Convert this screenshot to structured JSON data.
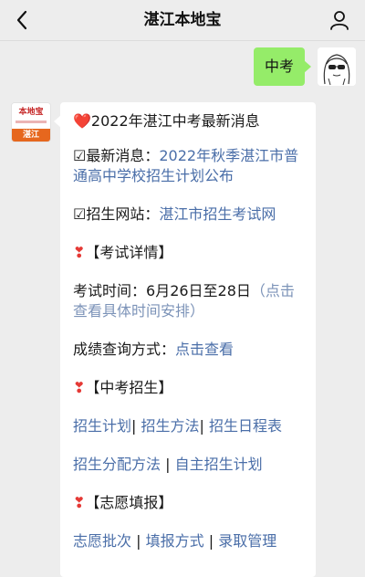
{
  "header": {
    "title": "湛江本地宝"
  },
  "outgoing_message": {
    "text": "中考"
  },
  "bot": {
    "logo_top": "本地宝",
    "logo_bottom": "湛江"
  },
  "reply": {
    "headline_icon": "❤️",
    "headline": "2022年湛江中考最新消息",
    "news_prefix": "☑最新消息：",
    "news_link": "2022年秋季湛江市普通高中学校招生计划公布",
    "site_prefix": "☑招生网站：",
    "site_link": "湛江市招生考试网",
    "section1_icon": "❣",
    "section1_title": "【考试详情】",
    "exam_time_label": "考试时间：",
    "exam_time_value": "6月26日至28日",
    "exam_time_note": "（点击查看具体时间安排）",
    "score_label": "成绩查询方式：",
    "score_link": "点击查看",
    "section2_icon": "❣",
    "section2_title": "【中考招生】",
    "links_row1": [
      "招生计划",
      "招生方法",
      "招生日程表"
    ],
    "links_row2": [
      "招生分配方法",
      "自主招生计划"
    ],
    "section3_icon": "❣",
    "section3_title": "【志愿填报】",
    "links_row3": [
      "志愿批次",
      "填报方式",
      "录取管理"
    ],
    "separator": "|"
  }
}
